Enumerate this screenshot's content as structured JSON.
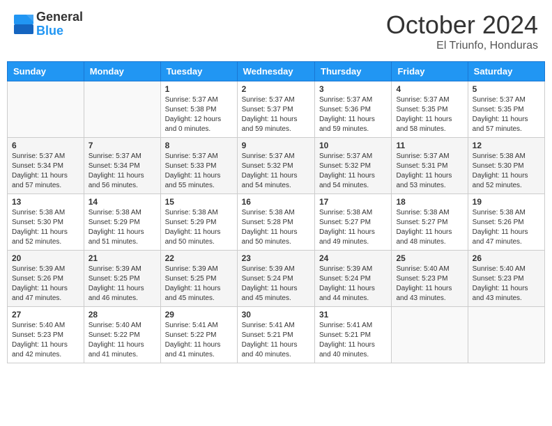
{
  "header": {
    "logo_general": "General",
    "logo_blue": "Blue",
    "month_title": "October 2024",
    "location": "El Triunfo, Honduras"
  },
  "days_of_week": [
    "Sunday",
    "Monday",
    "Tuesday",
    "Wednesday",
    "Thursday",
    "Friday",
    "Saturday"
  ],
  "weeks": [
    [
      {
        "day": "",
        "info": ""
      },
      {
        "day": "",
        "info": ""
      },
      {
        "day": "1",
        "info": "Sunrise: 5:37 AM\nSunset: 5:38 PM\nDaylight: 12 hours and 0 minutes."
      },
      {
        "day": "2",
        "info": "Sunrise: 5:37 AM\nSunset: 5:37 PM\nDaylight: 11 hours and 59 minutes."
      },
      {
        "day": "3",
        "info": "Sunrise: 5:37 AM\nSunset: 5:36 PM\nDaylight: 11 hours and 59 minutes."
      },
      {
        "day": "4",
        "info": "Sunrise: 5:37 AM\nSunset: 5:35 PM\nDaylight: 11 hours and 58 minutes."
      },
      {
        "day": "5",
        "info": "Sunrise: 5:37 AM\nSunset: 5:35 PM\nDaylight: 11 hours and 57 minutes."
      }
    ],
    [
      {
        "day": "6",
        "info": "Sunrise: 5:37 AM\nSunset: 5:34 PM\nDaylight: 11 hours and 57 minutes."
      },
      {
        "day": "7",
        "info": "Sunrise: 5:37 AM\nSunset: 5:34 PM\nDaylight: 11 hours and 56 minutes."
      },
      {
        "day": "8",
        "info": "Sunrise: 5:37 AM\nSunset: 5:33 PM\nDaylight: 11 hours and 55 minutes."
      },
      {
        "day": "9",
        "info": "Sunrise: 5:37 AM\nSunset: 5:32 PM\nDaylight: 11 hours and 54 minutes."
      },
      {
        "day": "10",
        "info": "Sunrise: 5:37 AM\nSunset: 5:32 PM\nDaylight: 11 hours and 54 minutes."
      },
      {
        "day": "11",
        "info": "Sunrise: 5:37 AM\nSunset: 5:31 PM\nDaylight: 11 hours and 53 minutes."
      },
      {
        "day": "12",
        "info": "Sunrise: 5:38 AM\nSunset: 5:30 PM\nDaylight: 11 hours and 52 minutes."
      }
    ],
    [
      {
        "day": "13",
        "info": "Sunrise: 5:38 AM\nSunset: 5:30 PM\nDaylight: 11 hours and 52 minutes."
      },
      {
        "day": "14",
        "info": "Sunrise: 5:38 AM\nSunset: 5:29 PM\nDaylight: 11 hours and 51 minutes."
      },
      {
        "day": "15",
        "info": "Sunrise: 5:38 AM\nSunset: 5:29 PM\nDaylight: 11 hours and 50 minutes."
      },
      {
        "day": "16",
        "info": "Sunrise: 5:38 AM\nSunset: 5:28 PM\nDaylight: 11 hours and 50 minutes."
      },
      {
        "day": "17",
        "info": "Sunrise: 5:38 AM\nSunset: 5:27 PM\nDaylight: 11 hours and 49 minutes."
      },
      {
        "day": "18",
        "info": "Sunrise: 5:38 AM\nSunset: 5:27 PM\nDaylight: 11 hours and 48 minutes."
      },
      {
        "day": "19",
        "info": "Sunrise: 5:38 AM\nSunset: 5:26 PM\nDaylight: 11 hours and 47 minutes."
      }
    ],
    [
      {
        "day": "20",
        "info": "Sunrise: 5:39 AM\nSunset: 5:26 PM\nDaylight: 11 hours and 47 minutes."
      },
      {
        "day": "21",
        "info": "Sunrise: 5:39 AM\nSunset: 5:25 PM\nDaylight: 11 hours and 46 minutes."
      },
      {
        "day": "22",
        "info": "Sunrise: 5:39 AM\nSunset: 5:25 PM\nDaylight: 11 hours and 45 minutes."
      },
      {
        "day": "23",
        "info": "Sunrise: 5:39 AM\nSunset: 5:24 PM\nDaylight: 11 hours and 45 minutes."
      },
      {
        "day": "24",
        "info": "Sunrise: 5:39 AM\nSunset: 5:24 PM\nDaylight: 11 hours and 44 minutes."
      },
      {
        "day": "25",
        "info": "Sunrise: 5:40 AM\nSunset: 5:23 PM\nDaylight: 11 hours and 43 minutes."
      },
      {
        "day": "26",
        "info": "Sunrise: 5:40 AM\nSunset: 5:23 PM\nDaylight: 11 hours and 43 minutes."
      }
    ],
    [
      {
        "day": "27",
        "info": "Sunrise: 5:40 AM\nSunset: 5:23 PM\nDaylight: 11 hours and 42 minutes."
      },
      {
        "day": "28",
        "info": "Sunrise: 5:40 AM\nSunset: 5:22 PM\nDaylight: 11 hours and 41 minutes."
      },
      {
        "day": "29",
        "info": "Sunrise: 5:41 AM\nSunset: 5:22 PM\nDaylight: 11 hours and 41 minutes."
      },
      {
        "day": "30",
        "info": "Sunrise: 5:41 AM\nSunset: 5:21 PM\nDaylight: 11 hours and 40 minutes."
      },
      {
        "day": "31",
        "info": "Sunrise: 5:41 AM\nSunset: 5:21 PM\nDaylight: 11 hours and 40 minutes."
      },
      {
        "day": "",
        "info": ""
      },
      {
        "day": "",
        "info": ""
      }
    ]
  ]
}
